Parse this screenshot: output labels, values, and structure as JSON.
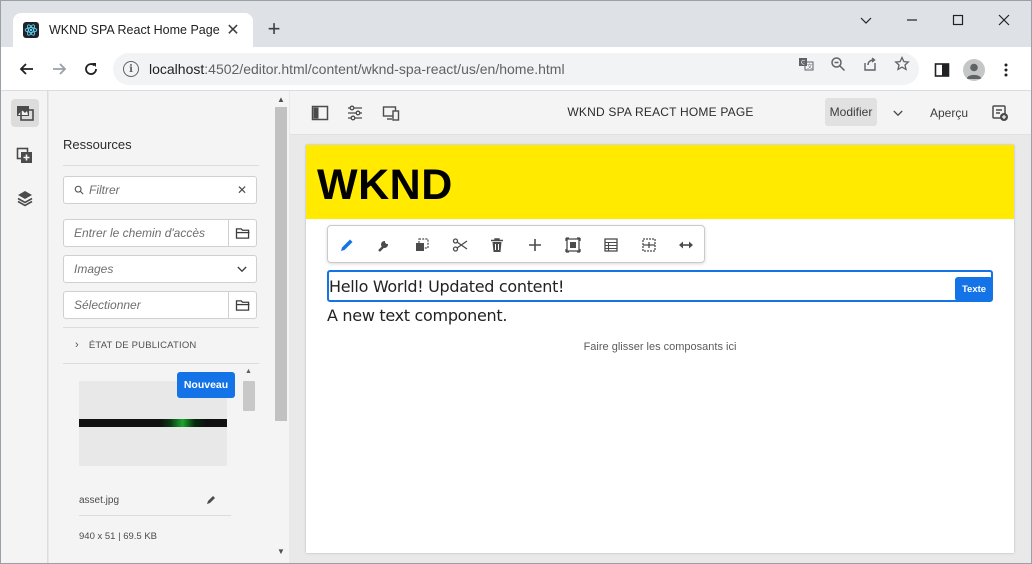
{
  "browser": {
    "tab_title": "WKND SPA React Home Page",
    "tab_close": "✕",
    "new_tab": "+",
    "url_host": "localhost",
    "url_rest": ":4502/editor.html/content/wknd-spa-react/us/en/home.html",
    "icons": [
      "back-icon",
      "forward-icon",
      "reload-icon",
      "info-icon",
      "translate-icon",
      "zoom-icon",
      "share-icon",
      "bookmark-star-icon",
      "side-panel-icon",
      "profile-icon",
      "more-icon"
    ],
    "window_controls": [
      "chevron-down-icon",
      "minimize-icon",
      "maximize-icon",
      "close-icon"
    ]
  },
  "rail": {
    "items": [
      "assets-icon",
      "components-icon",
      "content-tree-icon"
    ]
  },
  "sidepanel": {
    "title": "Ressources",
    "filter_placeholder": "Filtrer",
    "filter_clear": "✕",
    "path_placeholder": "Entrer le chemin d'accès",
    "type_selected": "Images",
    "select_placeholder": "Sélectionner",
    "publication_state": "ÉTAT DE PUBLICATION",
    "asset": {
      "badge": "Nouveau",
      "name": "asset.jpg",
      "meta": "940 x 51 | 69.5 KB"
    }
  },
  "editor_toolbar": {
    "page_title": "WKND SPA REACT HOME PAGE",
    "mode": "Modifier",
    "preview": "Aperçu"
  },
  "page": {
    "logo": "WKND",
    "selected_text": "Hello World! Updated content!",
    "component_label": "Texte",
    "second_text": "A new text component.",
    "dropzone": "Faire glisser les composants ici",
    "component_toolbar": [
      "edit-icon",
      "configure-icon",
      "copy-icon",
      "cut-icon",
      "delete-icon",
      "insert-icon",
      "group-icon",
      "parent-icon",
      "layout-icon",
      "resize-icon"
    ]
  },
  "colors": {
    "accent": "#1473e6",
    "banner": "#ffea00"
  }
}
